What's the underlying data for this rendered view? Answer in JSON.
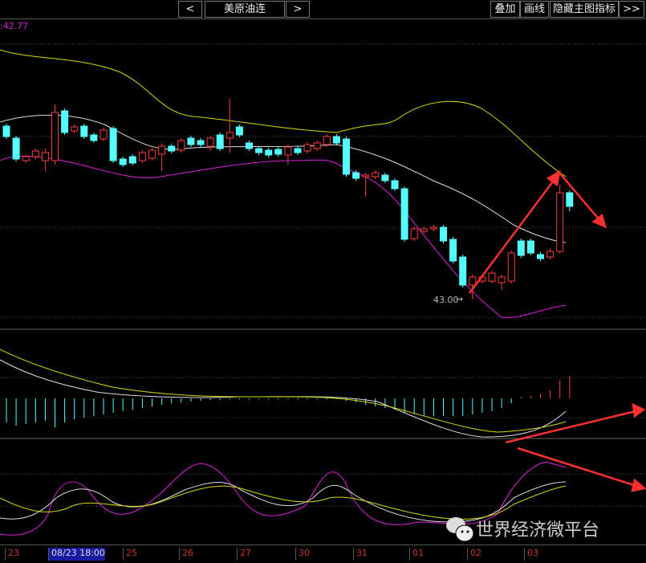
{
  "toolbar": {
    "prev": "<",
    "symbol": "美原油连",
    "next": ">",
    "overlay": "叠加",
    "draw": "画线",
    "hide_indicators": "隐藏主图指标",
    "more": ">>"
  },
  "main_label": ":42.77",
  "low_marker": "43.00",
  "watermark": "世界经济微平台",
  "colors": {
    "up": "#ff3c3c",
    "down": "#54ffff",
    "mid": "#dddddd",
    "upper": "#d8d800",
    "lower": "#e020e0"
  },
  "chart_data": {
    "type": "candlestick",
    "x_ticks": [
      "23",
      "08/23 18:00",
      "25",
      "26",
      "27",
      "30",
      "31",
      "01",
      "02",
      "03"
    ],
    "selected_tick": "08/23 18:00",
    "ohlc": [
      [
        45.16,
        45.19,
        45.0,
        45.03
      ],
      [
        45.01,
        45.04,
        44.72,
        44.75
      ],
      [
        44.73,
        44.8,
        44.7,
        44.78
      ],
      [
        44.78,
        44.88,
        44.75,
        44.85
      ],
      [
        44.73,
        44.88,
        44.6,
        44.83
      ],
      [
        44.73,
        45.43,
        44.68,
        45.33
      ],
      [
        45.35,
        45.38,
        45.05,
        45.08
      ],
      [
        45.1,
        45.18,
        45.07,
        45.15
      ],
      [
        45.16,
        45.19,
        45.0,
        45.03
      ],
      [
        45.05,
        45.08,
        44.95,
        44.98
      ],
      [
        45.0,
        45.14,
        44.97,
        45.11
      ],
      [
        45.13,
        45.16,
        44.7,
        44.73
      ],
      [
        44.75,
        44.78,
        44.65,
        44.68
      ],
      [
        44.78,
        44.81,
        44.67,
        44.7
      ],
      [
        44.73,
        44.86,
        44.7,
        44.83
      ],
      [
        44.76,
        44.89,
        44.73,
        44.86
      ],
      [
        44.81,
        44.94,
        44.6,
        44.91
      ],
      [
        44.91,
        44.94,
        44.82,
        44.85
      ],
      [
        44.86,
        45.01,
        44.83,
        44.98
      ],
      [
        45.01,
        45.04,
        44.9,
        44.93
      ],
      [
        44.98,
        45.01,
        44.9,
        44.93
      ],
      [
        44.91,
        45.04,
        44.85,
        45.01
      ],
      [
        45.05,
        45.08,
        44.85,
        44.88
      ],
      [
        45.01,
        45.5,
        44.83,
        45.08
      ],
      [
        45.15,
        45.18,
        45.02,
        45.05
      ],
      [
        44.95,
        44.98,
        44.85,
        44.88
      ],
      [
        44.88,
        44.91,
        44.8,
        44.83
      ],
      [
        44.86,
        44.89,
        44.77,
        44.8
      ],
      [
        44.87,
        44.9,
        44.78,
        44.81
      ],
      [
        44.8,
        44.93,
        44.68,
        44.9
      ],
      [
        44.88,
        44.91,
        44.8,
        44.83
      ],
      [
        44.85,
        44.96,
        44.82,
        44.93
      ],
      [
        44.88,
        44.98,
        44.85,
        44.95
      ],
      [
        44.93,
        45.06,
        44.9,
        45.03
      ],
      [
        45.03,
        45.06,
        44.92,
        44.95
      ],
      [
        45.0,
        45.03,
        44.53,
        44.56
      ],
      [
        44.58,
        44.61,
        44.48,
        44.51
      ],
      [
        44.53,
        44.58,
        44.28,
        44.55
      ],
      [
        44.53,
        44.61,
        44.5,
        44.58
      ],
      [
        44.55,
        44.58,
        44.45,
        44.48
      ],
      [
        44.48,
        44.51,
        44.35,
        44.38
      ],
      [
        44.38,
        44.41,
        43.72,
        43.75
      ],
      [
        43.76,
        43.91,
        43.73,
        43.88
      ],
      [
        43.85,
        43.91,
        43.82,
        43.88
      ],
      [
        43.88,
        43.93,
        43.85,
        43.9
      ],
      [
        43.9,
        43.93,
        43.7,
        43.73
      ],
      [
        43.75,
        43.78,
        43.45,
        43.48
      ],
      [
        43.53,
        43.56,
        43.15,
        43.18
      ],
      [
        43.18,
        43.31,
        43.0,
        43.28
      ],
      [
        43.23,
        43.31,
        43.2,
        43.28
      ],
      [
        43.23,
        43.36,
        43.2,
        43.33
      ],
      [
        43.21,
        43.31,
        43.12,
        43.28
      ],
      [
        43.23,
        43.61,
        43.2,
        43.58
      ],
      [
        43.73,
        43.76,
        43.52,
        43.55
      ],
      [
        43.73,
        43.76,
        43.55,
        43.58
      ],
      [
        43.56,
        43.59,
        43.48,
        43.51
      ],
      [
        43.53,
        43.63,
        43.5,
        43.6
      ],
      [
        43.6,
        44.43,
        43.57,
        44.33
      ],
      [
        44.33,
        44.36,
        44.1,
        44.16
      ]
    ],
    "macd_hist": [
      -0.3,
      -0.34,
      -0.32,
      -0.3,
      -0.28,
      -0.36,
      -0.3,
      -0.26,
      -0.24,
      -0.22,
      -0.2,
      -0.18,
      -0.16,
      -0.14,
      -0.12,
      -0.1,
      -0.08,
      -0.06,
      -0.05,
      -0.04,
      -0.03,
      -0.02,
      -0.02,
      -0.01,
      -0.01,
      -0.01,
      -0.01,
      -0.01,
      -0.01,
      -0.01,
      -0.01,
      -0.01,
      -0.01,
      -0.01,
      -0.01,
      -0.03,
      -0.05,
      -0.08,
      -0.1,
      -0.12,
      -0.14,
      -0.18,
      -0.2,
      -0.22,
      -0.22,
      -0.22,
      -0.22,
      -0.22,
      -0.2,
      -0.18,
      -0.16,
      -0.12,
      -0.06,
      0.02,
      0.03,
      0.06,
      0.1,
      0.22,
      0.28
    ]
  }
}
